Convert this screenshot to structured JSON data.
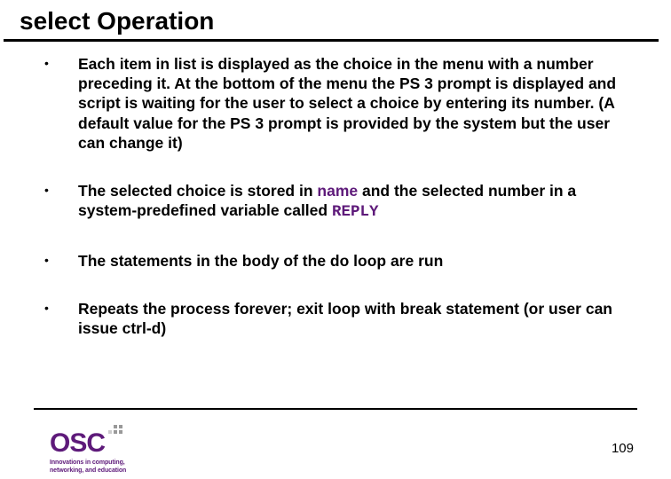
{
  "title": "select Operation",
  "bullets": {
    "b1": "Each item in list is displayed as the choice in the menu with a number preceding it. At the bottom of the menu the PS 3 prompt is displayed and script is waiting for the user to select a choice by entering its number. (A default value for the PS 3 prompt is provided by the system but the user can change it)",
    "b2_pre": "The selected choice is stored in ",
    "b2_name": "name",
    "b2_mid": " and the selected number in a system-predefined variable called ",
    "b2_reply": "REPLY",
    "b3": "The statements in the body of the do loop are run",
    "b4": "Repeats the process forever; exit loop with break statement (or user can issue ctrl-d)"
  },
  "logo": {
    "text": "OSC",
    "tag1": "Innovations in computing,",
    "tag2": "networking, and education"
  },
  "page_number": "109"
}
